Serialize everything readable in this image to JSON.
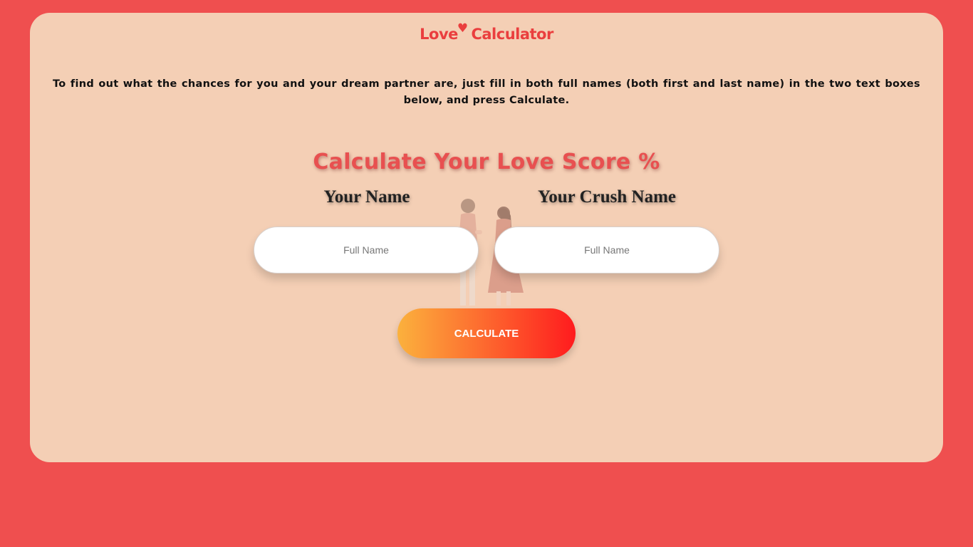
{
  "logo": {
    "part1": "Love",
    "heart": "♥",
    "part2": "Calculator"
  },
  "intro_text": "To find out what the chances for you and your dream partner are, just fill in both full names (both first and last name) in the two text boxes below, and press Calculate.",
  "heading": "Calculate Your Love Score %",
  "your_name": {
    "label": "Your Name",
    "value": "",
    "placeholder": "Full Name"
  },
  "crush_name": {
    "label": "Your Crush Name",
    "value": "",
    "placeholder": "Full Name"
  },
  "calculate_button": "CALCULATE",
  "colors": {
    "page_background": "#ef4f4f",
    "card_background": "#f4cfb5",
    "accent_red": "#ea3e3e",
    "button_gradient_start": "#fbb13d",
    "button_gradient_end": "#ff1b1e"
  }
}
